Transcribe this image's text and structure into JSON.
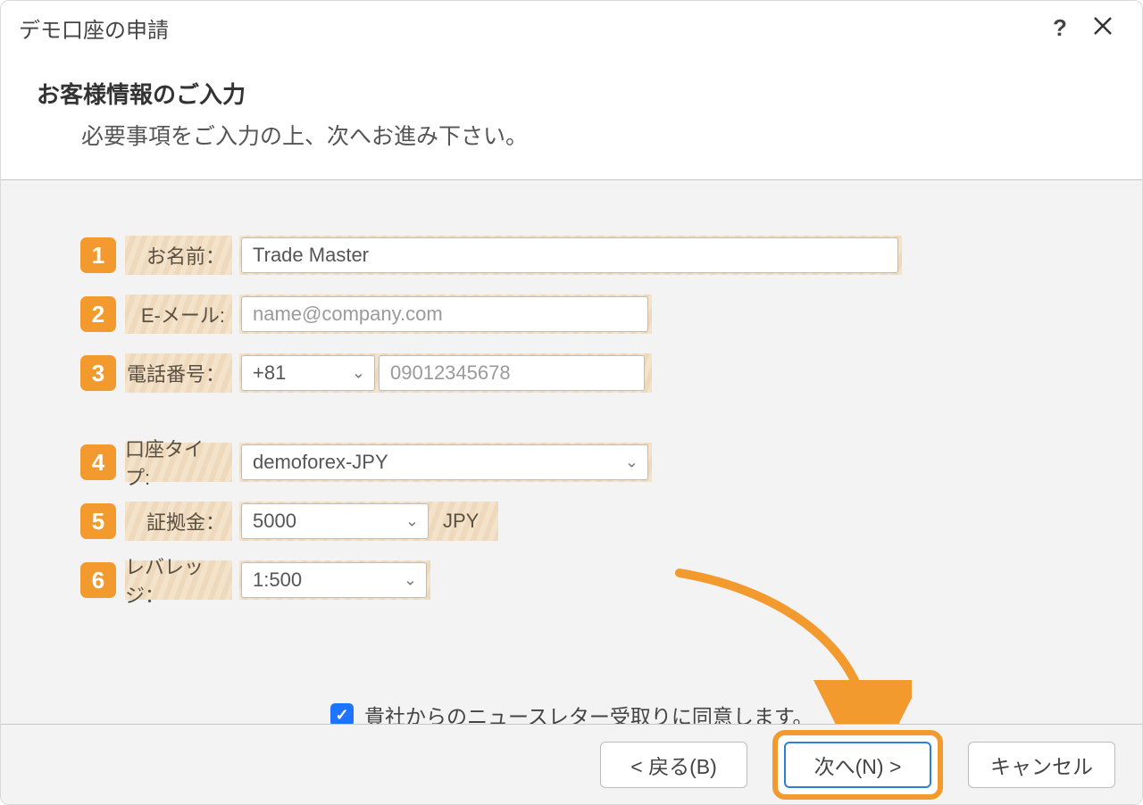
{
  "window": {
    "title": "デモ口座の申請"
  },
  "header": {
    "title": "お客様情報のご入力",
    "subtitle": "必要事項をご入力の上、次へお進み下さい。"
  },
  "steps": {
    "s1": "1",
    "s2": "2",
    "s3": "3",
    "s4": "4",
    "s5": "5",
    "s6": "6"
  },
  "labels": {
    "name": "お名前：",
    "email": "E-メール:",
    "phone": "電話番号：",
    "account_type": "口座タイプ:",
    "margin": "証拠金：",
    "leverage": "レバレッジ："
  },
  "fields": {
    "name_value": "Trade Master",
    "email_placeholder": "name@company.com",
    "phone_country": "+81",
    "phone_placeholder": "09012345678",
    "account_type_value": "demoforex-JPY",
    "margin_value": "5000",
    "margin_currency": "JPY",
    "leverage_value": "1:500"
  },
  "checkbox": {
    "checked": true,
    "label": "貴社からのニュースレター受取りに同意します。"
  },
  "buttons": {
    "back": "< 戻る(B)",
    "next": "次へ(N) >",
    "cancel": "キャンセル"
  }
}
